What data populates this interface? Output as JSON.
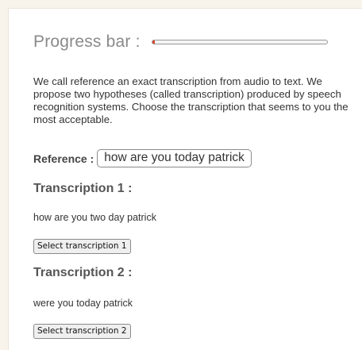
{
  "progress": {
    "label": "Progress bar :",
    "percent": 1.5,
    "fill_color": "#d9402b"
  },
  "intro_text": "We call reference an exact transcription from audio to text. We propose two hypotheses (called transcription) produced by speech recognition systems. Choose the transcription that seems to you the most acceptable.",
  "reference": {
    "label": "Reference :",
    "value": "how are you today patrick"
  },
  "transcriptions": [
    {
      "heading": "Transcription 1 :",
      "text": "how are you two day patrick",
      "button_label": "Select transcription 1"
    },
    {
      "heading": "Transcription 2 :",
      "text": "were you today patrick",
      "button_label": "Select transcription 2"
    }
  ]
}
